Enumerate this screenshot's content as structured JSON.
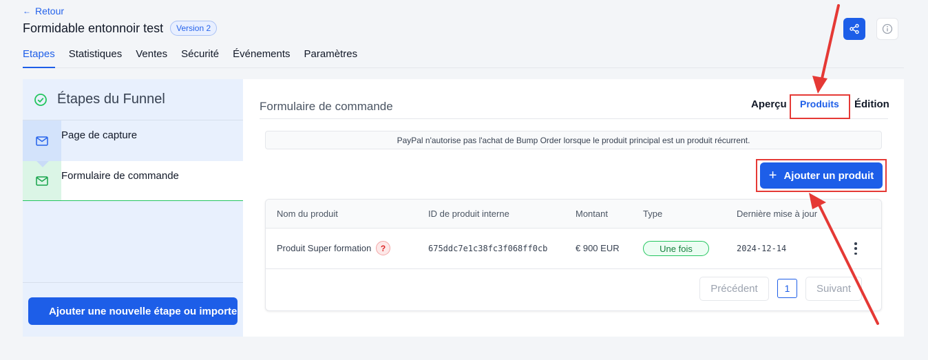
{
  "header": {
    "back_label": "Retour",
    "title": "Formidable entonnoir test",
    "version_badge": "Version 2"
  },
  "tabs": [
    {
      "label": "Etapes",
      "active": true
    },
    {
      "label": "Statistiques"
    },
    {
      "label": "Ventes"
    },
    {
      "label": "Sécurité"
    },
    {
      "label": "Événements"
    },
    {
      "label": "Paramètres"
    }
  ],
  "sidebar": {
    "title": "Étapes du Funnel",
    "steps": [
      {
        "label": "Page de capture"
      },
      {
        "label": "Formulaire de commande",
        "active": true
      }
    ],
    "add_step_label": "Ajouter une nouvelle étape ou importer"
  },
  "main": {
    "section_title": "Formulaire de commande",
    "sub_tabs": {
      "apercu": "Aperçu",
      "produits": "Produits",
      "edition": "Édition"
    },
    "notice": "PayPal n'autorise pas l'achat de Bump Order lorsque le produit principal est un produit récurrent.",
    "add_product_label": "Ajouter un produit",
    "table": {
      "headers": [
        "Nom du produit",
        "ID de produit interne",
        "Montant",
        "Type",
        "Dernière mise à jour"
      ],
      "rows": [
        {
          "name": "Produit Super formation",
          "help": "?",
          "id": "675ddc7e1c38fc3f068ff0cb",
          "amount": "€ 900 EUR",
          "type": "Une fois",
          "updated": "2024-12-14"
        }
      ]
    },
    "pagination": {
      "prev": "Précédent",
      "page": "1",
      "next": "Suivant"
    }
  },
  "colors": {
    "accent": "#1d5ee8",
    "annotation": "#e53935",
    "success": "#22c55e"
  }
}
